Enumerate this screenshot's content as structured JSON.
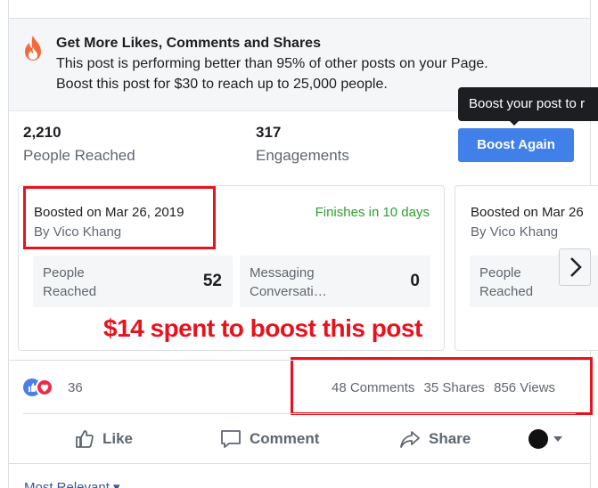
{
  "promo": {
    "title": "Get More Likes, Comments and Shares",
    "line1": "This post is performing better than 95% of other posts on your Page.",
    "line2": "Boost this post for $30 to reach up to 25,000 people."
  },
  "stats": {
    "reached_value": "2,210",
    "reached_label": "People Reached",
    "engagements_value": "317",
    "engagements_label": "Engagements"
  },
  "tooltip": "Boost your post to r",
  "boost_again_label": "Boost Again",
  "boost_cards": [
    {
      "date": "Boosted on Mar 26, 2019",
      "by": "By Vico Khang",
      "finish": "Finishes in 10 days",
      "metrics": [
        {
          "label": "People Reached",
          "value": "52"
        },
        {
          "label": "Messaging Conversati…",
          "value": "0"
        }
      ]
    },
    {
      "date": "Boosted on Mar 26",
      "by": "By Vico Khang",
      "metrics": [
        {
          "label": "People Reached"
        }
      ]
    }
  ],
  "annotation": "$14 spent to boost this post",
  "reactions": {
    "count": "36"
  },
  "counts": {
    "comments": "48 Comments",
    "shares": "35 Shares",
    "views": "856 Views"
  },
  "actions": {
    "like": "Like",
    "comment": "Comment",
    "share": "Share"
  },
  "sort_label": "Most Relevant ▾",
  "colors": {
    "accent": "#4080e8",
    "annotation_red": "#e8121d",
    "finish_green": "#2e9e2e"
  }
}
